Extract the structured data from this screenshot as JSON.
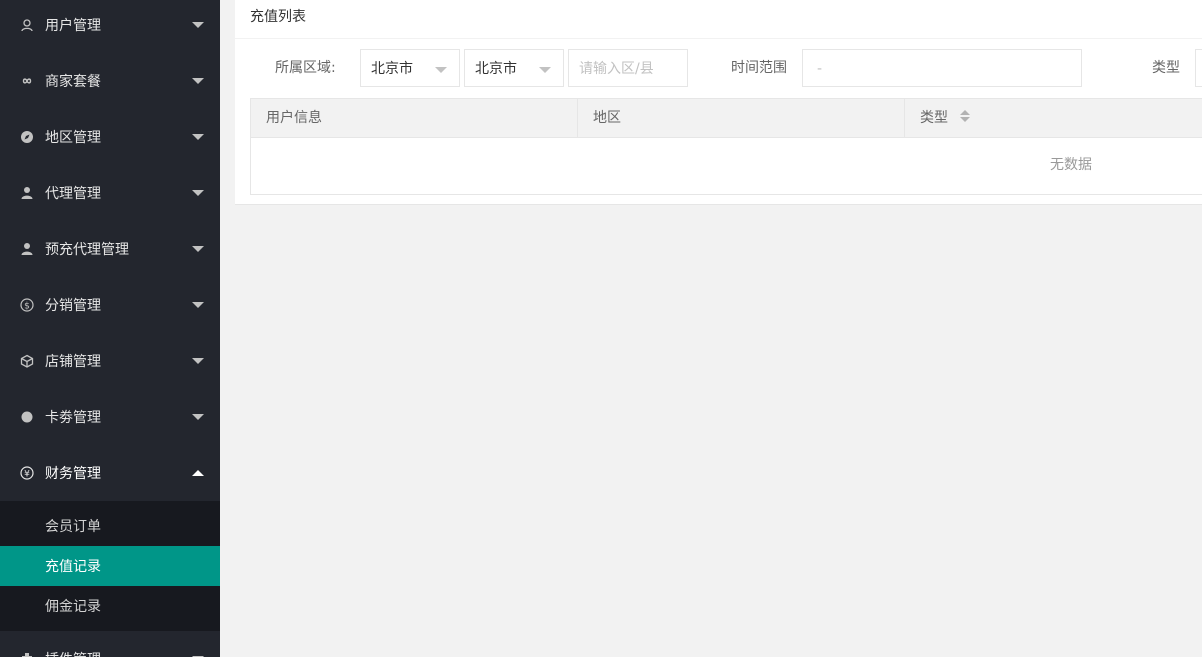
{
  "sidebar": {
    "items": [
      {
        "label": "用户管理",
        "icon": "user-icon"
      },
      {
        "label": "商家套餐",
        "icon": "infinity-icon"
      },
      {
        "label": "地区管理",
        "icon": "compass-icon"
      },
      {
        "label": "代理管理",
        "icon": "person-icon"
      },
      {
        "label": "预充代理管理",
        "icon": "person-icon"
      },
      {
        "label": "分销管理",
        "icon": "dollar-icon"
      },
      {
        "label": "店铺管理",
        "icon": "cube-icon"
      },
      {
        "label": "卡劵管理",
        "icon": "circle-icon"
      },
      {
        "label": "财务管理",
        "icon": "yen-icon"
      }
    ],
    "submenu": [
      "会员订单",
      "充值记录",
      "佣金记录"
    ],
    "next_item": {
      "label": "插件管理",
      "icon": "plugin-icon"
    }
  },
  "card": {
    "title": "充值列表"
  },
  "filter": {
    "region_label": "所属区域:",
    "province": "北京市",
    "city": "北京市",
    "district_placeholder": "请输入区/县",
    "time_label": "时间范围",
    "time_placeholder": "-",
    "type_label": "类型"
  },
  "table": {
    "columns": [
      "用户信息",
      "地区",
      "类型"
    ],
    "empty_text": "无数据"
  }
}
